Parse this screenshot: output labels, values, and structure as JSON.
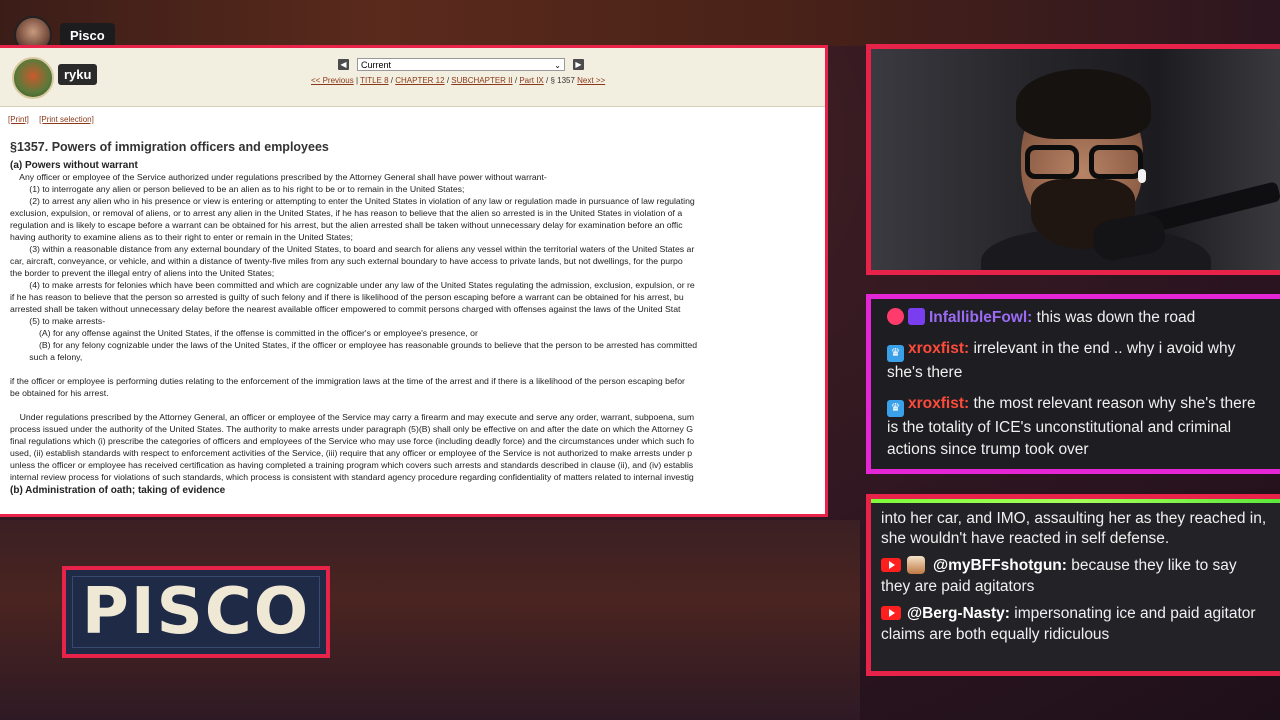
{
  "streamer": {
    "name": "Pisco"
  },
  "browser": {
    "account_label": "ryku",
    "select_value": "Current",
    "crumbs": {
      "prev": "<< Previous",
      "title": "TITLE 8",
      "chapter": "CHAPTER 12",
      "subchapter": "SUBCHAPTER II",
      "part": "Part IX",
      "section": "§ 1357",
      "next": "Next >>"
    },
    "print": "[Print]",
    "print_selection": "[Print selection]",
    "doc": {
      "title": "§1357. Powers of immigration officers and employees",
      "heading_a": "(a) Powers without warrant",
      "lines_a": [
        "    Any officer or employee of the Service authorized under regulations prescribed by the Attorney General shall have power without warrant-",
        "        (1) to interrogate any alien or person believed to be an alien as to his right to be or to remain in the United States;",
        "        (2) to arrest any alien who in his presence or view is entering or attempting to enter the United States in violation of any law or regulation made in pursuance of law regulating",
        "exclusion, expulsion, or removal of aliens, or to arrest any alien in the United States, if he has reason to believe that the alien so arrested is in the United States in violation of a",
        "regulation and is likely to escape before a warrant can be obtained for his arrest, but the alien arrested shall be taken without unnecessary delay for examination before an offic",
        "having authority to examine aliens as to their right to enter or remain in the United States;",
        "        (3) within a reasonable distance from any external boundary of the United States, to board and search for aliens any vessel within the territorial waters of the United States ar",
        "car, aircraft, conveyance, or vehicle, and within a distance of twenty-five miles from any such external boundary to have access to private lands, but not dwellings, for the purpo",
        "the border to prevent the illegal entry of aliens into the United States;",
        "        (4) to make arrests for felonies which have been committed and which are cognizable under any law of the United States regulating the admission, exclusion, expulsion, or re",
        "if he has reason to believe that the person so arrested is guilty of such felony and if there is likelihood of the person escaping before a warrant can be obtained for his arrest, bu",
        "arrested shall be taken without unnecessary delay before the nearest available officer empowered to commit persons charged with offenses against the laws of the United Stat",
        "        (5) to make arrests-",
        "            (A) for any offense against the United States, if the offense is committed in the officer's or employee's presence, or",
        "            (B) for any felony cognizable under the laws of the United States, if the officer or employee has reasonable grounds to believe that the person to be arrested has committed",
        "        such a felony,"
      ],
      "lines_b": [
        "if the officer or employee is performing duties relating to the enforcement of the immigration laws at the time of the arrest and if there is a likelihood of the person escaping befor",
        "be obtained for his arrest."
      ],
      "lines_c": [
        "    Under regulations prescribed by the Attorney General, an officer or employee of the Service may carry a firearm and may execute and serve any order, warrant, subpoena, sum",
        "process issued under the authority of the United States. The authority to make arrests under paragraph (5)(B) shall only be effective on and after the date on which the Attorney G",
        "final regulations which (i) prescribe the categories of officers and employees of the Service who may use force (including deadly force) and the circumstances under which such fo",
        "used, (ii) establish standards with respect to enforcement activities of the Service, (iii) require that any officer or employee of the Service is not authorized to make arrests under p",
        "unless the officer or employee has received certification as having completed a training program which covers such arrests and standards described in clause (ii), and (iv) establis",
        "internal review process for violations of such standards, which process is consistent with standard agency procedure regarding confidentiality of matters related to internal investig"
      ],
      "heading_b": "(b) Administration of oath; taking of evidence"
    }
  },
  "chat_top": [
    {
      "user": "InfallibleFowl:",
      "text": " this was down the road"
    },
    {
      "user": "xroxfist:",
      "text": " irrelevant in the end .. why i avoid why she's there"
    },
    {
      "user": "xroxfist:",
      "text": " the most relevant reason why she's there is the totality of ICE's unconstitutional and criminal actions since trump took over"
    }
  ],
  "chat_bottom": {
    "partial": "into her car, and IMO, assaulting her as they reached in, she wouldn't have reacted in self defense.",
    "messages": [
      {
        "user": "@myBFFshotgun:",
        "text": " because they like to say they are paid agitators"
      },
      {
        "user": "@Berg-Nasty:",
        "text": " impersonating ice and paid agitator claims are both equally ridiculous"
      }
    ]
  },
  "logo": {
    "text": "PISCO"
  },
  "colors": {
    "frame_red": "#e8234a",
    "frame_magenta": "#e426d6",
    "chat_top_accent": "#7dfc3a"
  }
}
